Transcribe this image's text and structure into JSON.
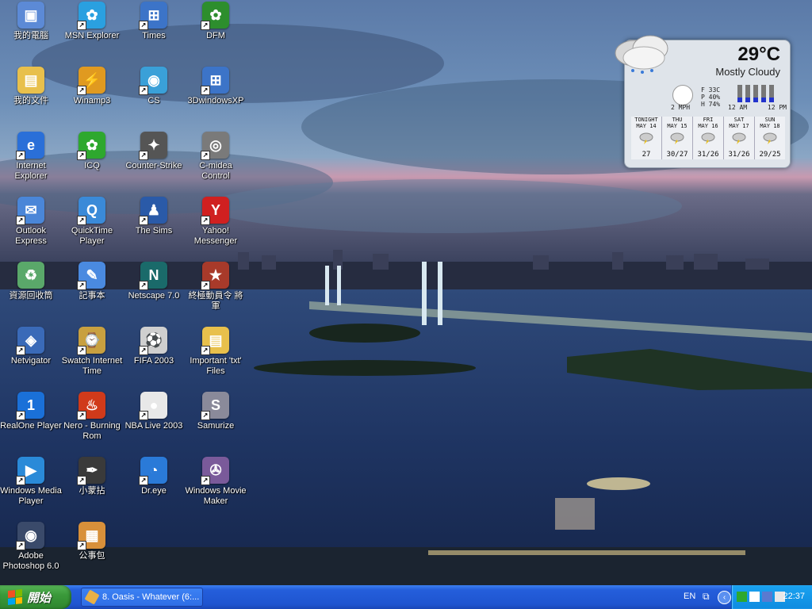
{
  "desktop": {
    "icons": [
      {
        "label": "我的電腦",
        "name": "my-computer-icon",
        "color": "#5c8ad6",
        "glyph": "▣"
      },
      {
        "label": "MSN Explorer",
        "name": "msn-explorer-icon",
        "color": "#2aa0e0",
        "glyph": "✿"
      },
      {
        "label": "Times",
        "name": "times-icon",
        "color": "#3c74c8",
        "glyph": "⊞"
      },
      {
        "label": "DFM",
        "name": "dfm-icon",
        "color": "#2d8e2d",
        "glyph": "✿"
      },
      {
        "label": "我的文件",
        "name": "my-documents-icon",
        "color": "#e8c04c",
        "glyph": "▤"
      },
      {
        "label": "Winamp3",
        "name": "winamp-icon",
        "color": "#e09a20",
        "glyph": "⚡"
      },
      {
        "label": "CS",
        "name": "cs-icon",
        "color": "#3aa0d8",
        "glyph": "◉"
      },
      {
        "label": "3DwindowsXP",
        "name": "3dwindowsxp-icon",
        "color": "#3c74c8",
        "glyph": "⊞"
      },
      {
        "label": "Internet Explorer",
        "name": "internet-explorer-icon",
        "color": "#2a6fd8",
        "glyph": "e"
      },
      {
        "label": "ICQ",
        "name": "icq-icon",
        "color": "#2ea82e",
        "glyph": "✿"
      },
      {
        "label": "Counter-Strike",
        "name": "counter-strike-icon",
        "color": "#555555",
        "glyph": "✦"
      },
      {
        "label": "C-midea Control",
        "name": "c-midea-control-icon",
        "color": "#7a7a7a",
        "glyph": "◎"
      },
      {
        "label": "Outlook Express",
        "name": "outlook-express-icon",
        "color": "#4a86d8",
        "glyph": "✉"
      },
      {
        "label": "QuickTime Player",
        "name": "quicktime-icon",
        "color": "#3a8ad8",
        "glyph": "Q"
      },
      {
        "label": "The Sims",
        "name": "the-sims-icon",
        "color": "#2a5aa8",
        "glyph": "♟"
      },
      {
        "label": "Yahoo! Messenger",
        "name": "yahoo-messenger-icon",
        "color": "#d02020",
        "glyph": "Y"
      },
      {
        "label": "資源回收筒",
        "name": "recycle-bin-icon",
        "color": "#5aa86a",
        "glyph": "♻"
      },
      {
        "label": "記事本",
        "name": "notepad-icon",
        "color": "#4a8ae0",
        "glyph": "✎"
      },
      {
        "label": "Netscape 7.0",
        "name": "netscape-icon",
        "color": "#1a6a6a",
        "glyph": "N"
      },
      {
        "label": "終極動員令 將軍",
        "name": "generals-icon",
        "color": "#a83a2a",
        "glyph": "★"
      },
      {
        "label": "Netvigator",
        "name": "netvigator-icon",
        "color": "#3a6ab8",
        "glyph": "◈"
      },
      {
        "label": "Swatch Internet Time",
        "name": "swatch-icon",
        "color": "#c8a040",
        "glyph": "⌚"
      },
      {
        "label": "FIFA 2003",
        "name": "fifa-icon",
        "color": "#cfcfcf",
        "glyph": "⚽"
      },
      {
        "label": "Important 'txt' Files",
        "name": "important-files-icon",
        "color": "#e8c04c",
        "glyph": "▤"
      },
      {
        "label": "RealOne Player",
        "name": "realone-icon",
        "color": "#1a70d8",
        "glyph": "1"
      },
      {
        "label": "Nero - Burning Rom",
        "name": "nero-icon",
        "color": "#d03a1a",
        "glyph": "♨"
      },
      {
        "label": "NBA Live 2003",
        "name": "nba-live-icon",
        "color": "#e8e8e8",
        "glyph": "●"
      },
      {
        "label": "Samurize",
        "name": "samurize-icon",
        "color": "#8a8a9a",
        "glyph": "S"
      },
      {
        "label": "Windows Media Player",
        "name": "windows-media-player-icon",
        "color": "#2a8ad8",
        "glyph": "▶"
      },
      {
        "label": "小蒙拈",
        "name": "pen-tool-icon",
        "color": "#3a3a3a",
        "glyph": "✒"
      },
      {
        "label": "Dr.eye",
        "name": "dreye-icon",
        "color": "#2a7ad8",
        "glyph": "◔"
      },
      {
        "label": "Windows Movie Maker",
        "name": "windows-movie-maker-icon",
        "color": "#7a5a9a",
        "glyph": "✇"
      },
      {
        "label": "Adobe Photoshop 6.0",
        "name": "photoshop-icon",
        "color": "#3a4a6a",
        "glyph": "◉"
      },
      {
        "label": "公事包",
        "name": "briefcase-icon",
        "color": "#d8903a",
        "glyph": "▦"
      }
    ]
  },
  "weather": {
    "temperature": "29°C",
    "condition": "Mostly Cloudy",
    "stats": [
      "F 33C",
      "P 40%",
      "H 74%"
    ],
    "wind": "2 MPH",
    "time_left": "12 AM",
    "time_right": "12 PM",
    "forecast": [
      {
        "day": "TONIGHT",
        "date": "MAY 14",
        "temps": "27"
      },
      {
        "day": "THU",
        "date": "MAY 15",
        "temps": "30/27"
      },
      {
        "day": "FRI",
        "date": "MAY 16",
        "temps": "31/26"
      },
      {
        "day": "SAT",
        "date": "MAY 17",
        "temps": "31/26"
      },
      {
        "day": "SUN",
        "date": "MAY 18",
        "temps": "29/25"
      }
    ]
  },
  "taskbar": {
    "start_label": "開始",
    "tasks": [
      {
        "label": "8. Oasis - Whatever (6:..."
      }
    ],
    "language": "EN",
    "clock": "22:37"
  }
}
